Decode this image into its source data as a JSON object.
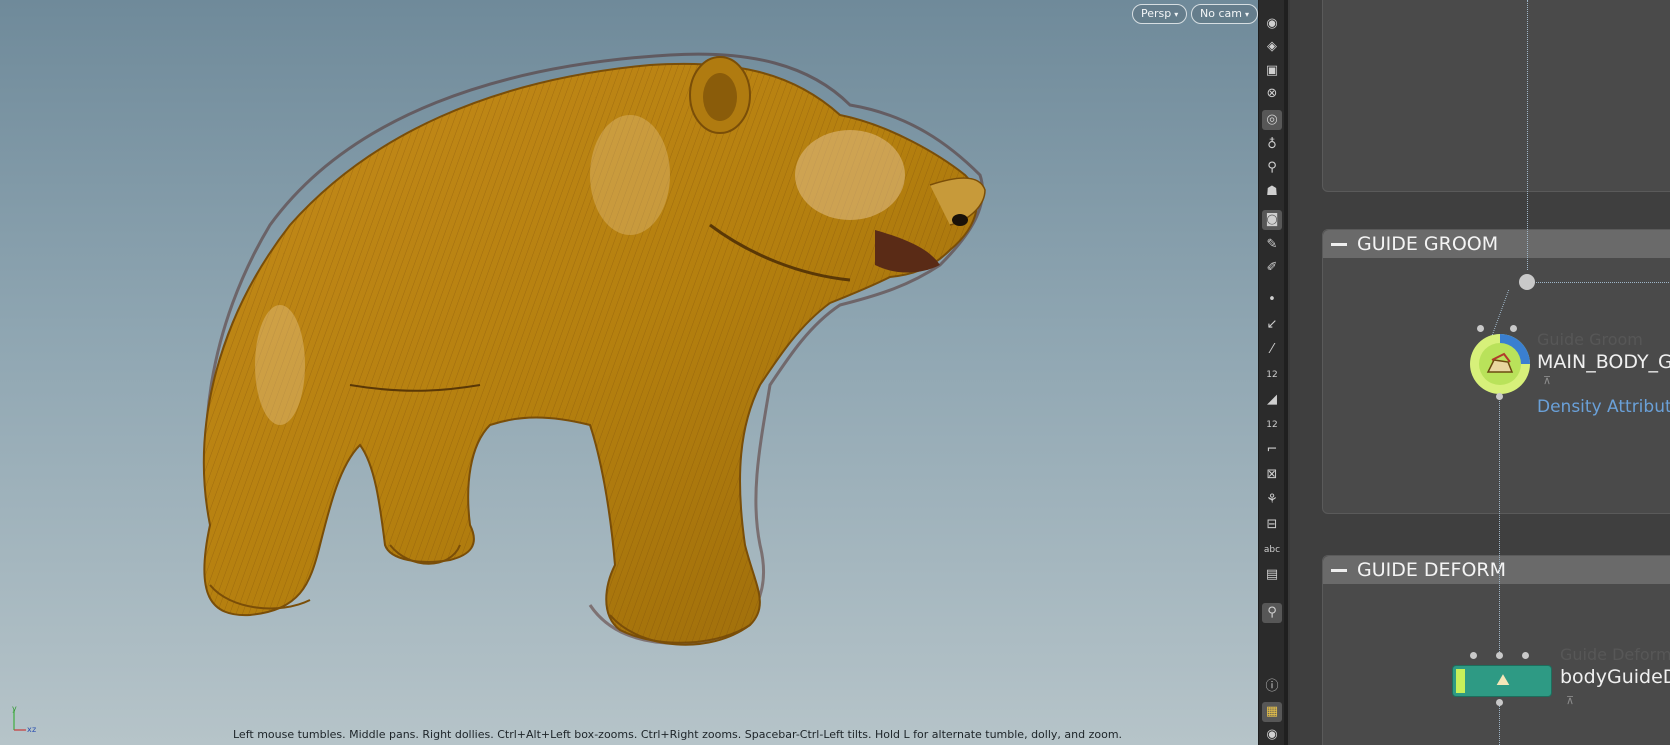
{
  "viewport": {
    "persp_label": "Persp",
    "cam_label": "No cam",
    "status": "Left mouse tumbles. Middle pans. Right dollies. Ctrl+Alt+Left box-zooms. Ctrl+Right zooms. Spacebar-Ctrl-Left tilts. Hold L for alternate tumble, dolly, and zoom.",
    "axis": {
      "y": "y",
      "x": "x",
      "z": "z"
    }
  },
  "toolbar": {
    "icons": [
      "eye-icon",
      "visibility-icon",
      "lock-icon",
      "close-circle-icon",
      "select-icon",
      "light-icon",
      "light-add-icon",
      "skull-icon",
      "camera-icon",
      "wand-icon",
      "brush-icon",
      "point-icon",
      "arrow-icon",
      "dropper-icon",
      "number-icon",
      "eraser-icon",
      "number-tool-icon",
      "corner-icon",
      "snap-icon",
      "pin-icon",
      "grid-icon",
      "text-icon",
      "image-icon",
      "pin-active-icon",
      "info-icon",
      "layout-icon",
      "eye-bottom-icon"
    ],
    "text_label": "abc",
    "number_label": "12"
  },
  "network": {
    "boxes": [
      {
        "title": "GUIDE GROOM"
      },
      {
        "title": "GUIDE DEFORM"
      }
    ],
    "nodes": {
      "groom_ghost": "Guide Groom",
      "groom_name": "MAIN_BODY_G",
      "groom_comment": "Density Attribut",
      "deform_ghost": "Guide Deform",
      "deform_name": "bodyGuideD"
    }
  }
}
